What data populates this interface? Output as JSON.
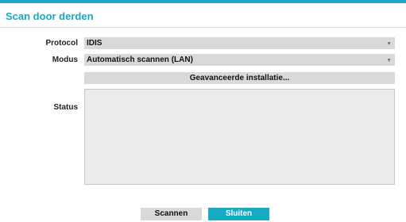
{
  "dialog": {
    "title": "Scan door derden",
    "accent_color": "#1aa9c4"
  },
  "fields": {
    "protocol": {
      "label": "Protocol",
      "value": "IDIS"
    },
    "modus": {
      "label": "Modus",
      "value": "Automatisch scannen (LAN)"
    }
  },
  "advanced_button": {
    "label": "Geavanceerde installatie..."
  },
  "status": {
    "label": "Status"
  },
  "buttons": {
    "scan": "Scannen",
    "close": "Sluiten"
  },
  "icons": {
    "dropdown": "chevron-down-icon"
  }
}
